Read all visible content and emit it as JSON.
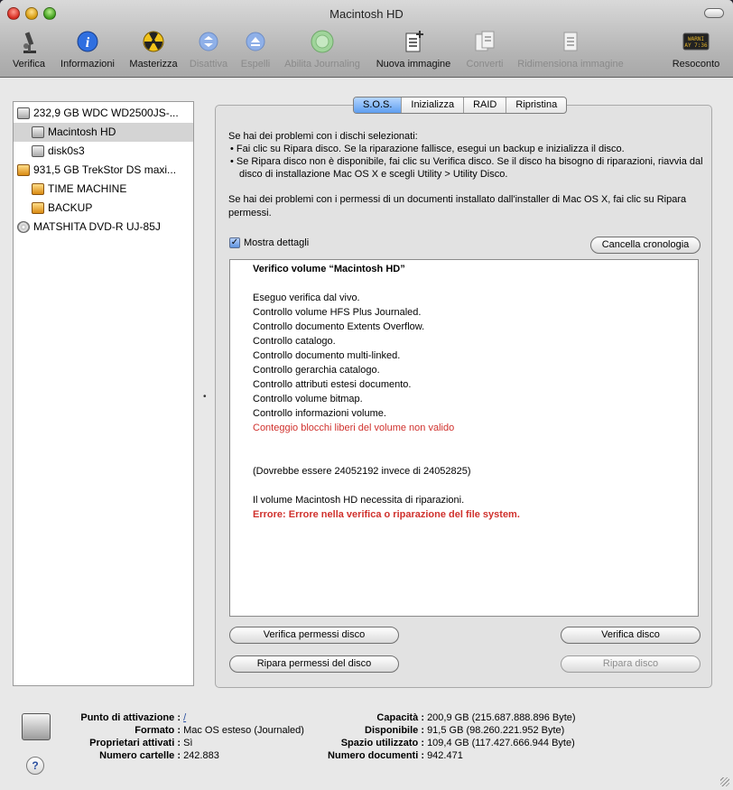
{
  "window": {
    "title": "Macintosh HD"
  },
  "toolbar": [
    {
      "label": "Verifica",
      "icon": "microscope-icon",
      "enabled": true
    },
    {
      "label": "Informazioni",
      "icon": "info-icon",
      "enabled": true
    },
    {
      "label": "Masterizza",
      "icon": "burn-icon",
      "enabled": true
    },
    {
      "label": "Disattiva",
      "icon": "unmount-icon",
      "enabled": false
    },
    {
      "label": "Espelli",
      "icon": "eject-icon",
      "enabled": false
    },
    {
      "label": "Abilita Journaling",
      "icon": "journaling-icon",
      "enabled": false
    },
    {
      "label": "Nuova immagine",
      "icon": "new-image-icon",
      "enabled": true
    },
    {
      "label": "Converti",
      "icon": "convert-icon",
      "enabled": false
    },
    {
      "label": "Ridimensiona immagine",
      "icon": "resize-image-icon",
      "enabled": false
    },
    {
      "label": "Resoconto",
      "icon": "log-icon",
      "enabled": true
    }
  ],
  "sidebar": [
    {
      "label": "232,9 GB WDC WD2500JS-...",
      "kind": "hdd",
      "indent": 0,
      "selected": false
    },
    {
      "label": "Macintosh HD",
      "kind": "hdd",
      "indent": 1,
      "selected": true
    },
    {
      "label": "disk0s3",
      "kind": "hdd",
      "indent": 1,
      "selected": false
    },
    {
      "label": "931,5 GB TrekStor DS maxi...",
      "kind": "ext",
      "indent": 0,
      "selected": false
    },
    {
      "label": "TIME MACHINE",
      "kind": "ext",
      "indent": 1,
      "selected": false
    },
    {
      "label": "BACKUP",
      "kind": "ext",
      "indent": 1,
      "selected": false
    },
    {
      "label": "MATSHITA DVD-R UJ-85J",
      "kind": "cd",
      "indent": 0,
      "selected": false
    }
  ],
  "tabs": [
    {
      "label": "S.O.S.",
      "active": true
    },
    {
      "label": "Inizializza",
      "active": false
    },
    {
      "label": "RAID",
      "active": false
    },
    {
      "label": "Ripristina",
      "active": false
    }
  ],
  "sos": {
    "intro_heading": "Se hai dei problemi con i dischi selezionati:",
    "bullet1": "• Fai clic su Ripara disco. Se la riparazione fallisce, esegui un backup e inizializza il disco.",
    "bullet2": "• Se Ripara disco non è disponibile, fai clic su Verifica disco. Se il disco ha bisogno di riparazioni, riavvia dal disco di installazione Mac OS X e scegli Utility > Utility Disco.",
    "permissions_text": "Se hai dei problemi con i permessi di un documenti installato dall'installer di Mac OS X, fai clic su Ripara permessi.",
    "show_details_label": "Mostra dettagli",
    "show_details_checked": true,
    "clear_history_label": "Cancella cronologia",
    "log_lines": [
      {
        "text": "Verifico volume “Macintosh HD”",
        "style": "b"
      },
      {
        "text": "",
        "style": ""
      },
      {
        "text": "Eseguo verifica dal vivo.",
        "style": ""
      },
      {
        "text": "Controllo volume HFS Plus Journaled.",
        "style": ""
      },
      {
        "text": "Controllo documento Extents Overflow.",
        "style": ""
      },
      {
        "text": "Controllo catalogo.",
        "style": ""
      },
      {
        "text": "Controllo documento multi-linked.",
        "style": ""
      },
      {
        "text": "Controllo gerarchia catalogo.",
        "style": ""
      },
      {
        "text": "Controllo attributi estesi documento.",
        "style": ""
      },
      {
        "text": "Controllo volume bitmap.",
        "style": ""
      },
      {
        "text": "Controllo informazioni volume.",
        "style": ""
      },
      {
        "text": "Conteggio blocchi liberi del volume non valido",
        "style": "red"
      },
      {
        "text": "",
        "style": ""
      },
      {
        "text": "",
        "style": ""
      },
      {
        "text": "(Dovrebbe essere 24052192 invece di 24052825)",
        "style": ""
      },
      {
        "text": "",
        "style": ""
      },
      {
        "text": "Il volume Macintosh HD necessita di riparazioni.",
        "style": ""
      },
      {
        "text": "Errore: Errore nella verifica o riparazione del file system.",
        "style": "redb"
      }
    ],
    "verify_permissions_label": "Verifica permessi disco",
    "repair_permissions_label": "Ripara permessi del disco",
    "verify_disk_label": "Verifica disco",
    "repair_disk_label": "Ripara disco",
    "repair_disk_enabled": false
  },
  "info": {
    "left": [
      {
        "key": "Punto di attivazione :",
        "value": "/",
        "link": true
      },
      {
        "key": "Formato :",
        "value": "Mac OS esteso (Journaled)"
      },
      {
        "key": "Proprietari attivati :",
        "value": "Sì"
      },
      {
        "key": "Numero cartelle :",
        "value": "242.883"
      }
    ],
    "right": [
      {
        "key": "Capacità :",
        "value": "200,9 GB (215.687.888.896 Byte)"
      },
      {
        "key": "Disponibile :",
        "value": "91,5 GB (98.260.221.952 Byte)"
      },
      {
        "key": "Spazio utilizzato :",
        "value": "109,4 GB (117.427.666.944 Byte)"
      },
      {
        "key": "Numero documenti :",
        "value": "942.471"
      }
    ],
    "help_label": "?"
  }
}
